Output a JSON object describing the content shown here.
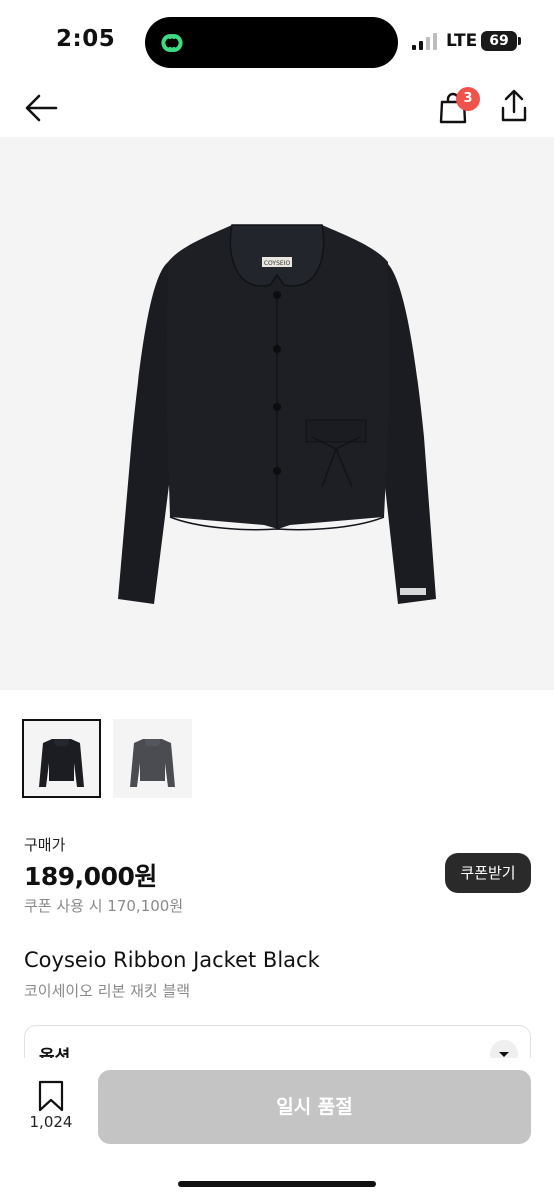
{
  "status_bar": {
    "time": "2:05",
    "network": "LTE",
    "battery": "69"
  },
  "nav": {
    "back_icon": "arrow-left-icon",
    "bag_icon": "shopping-bag-icon",
    "bag_count": "3",
    "share_icon": "share-icon",
    "badge_color": "#f0524c"
  },
  "product": {
    "jacket_label": "COYSEIO",
    "thumbnails": [
      {
        "color": "black",
        "selected": true
      },
      {
        "color": "charcoal",
        "selected": false
      }
    ],
    "price_label": "구매가",
    "price": "189,000원",
    "coupon_price": "쿠폰 사용 시 170,100원",
    "coupon_button": "쿠폰받기",
    "title_en": "Coyseio Ribbon Jacket Black",
    "title_ko": "코이세이오 리본 재킷 블랙"
  },
  "options": {
    "label": "옵션",
    "chevron_icon": "chevron-down-icon"
  },
  "bottom_bar": {
    "bookmark_icon": "bookmark-icon",
    "bookmark_count": "1,024",
    "action_button": "일시 품절",
    "action_color": "#c4c4c4"
  }
}
